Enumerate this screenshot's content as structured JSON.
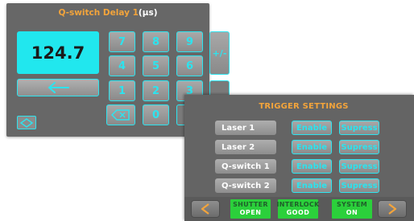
{
  "keypad": {
    "title_main": "Q-switch Delay 1",
    "title_unit": "(µs)",
    "display_value": "124.7",
    "keys": [
      "7",
      "8",
      "9",
      "4",
      "5",
      "6",
      "1",
      "2",
      "3",
      "0"
    ],
    "plus_minus": "+/-",
    "icons": {
      "back_arrow": "left-arrow-icon",
      "backspace": "backspace-icon",
      "toggle": "up-down-chevron-icon"
    },
    "accent_color": "#21e7ee",
    "title_highlight_color": "#f3a43b"
  },
  "trigger": {
    "title": "TRIGGER SETTINGS",
    "rows": [
      {
        "name": "Laser 1",
        "enable": "Enable",
        "supress": "Supress"
      },
      {
        "name": "Laser 2",
        "enable": "Enable",
        "supress": "Supress"
      },
      {
        "name": "Q-switch 1",
        "enable": "Enable",
        "supress": "Supress"
      },
      {
        "name": "Q-switch 2",
        "enable": "Enable",
        "supress": "Supress"
      }
    ],
    "status": [
      {
        "label": "SHUTTER",
        "state": "OPEN"
      },
      {
        "label": "INTERLOCK",
        "state": "GOOD"
      },
      {
        "label": "SYSTEM",
        "state": "ON"
      }
    ],
    "nav_icons": {
      "prev": "chevron-left-icon",
      "next": "chevron-right-icon"
    },
    "status_color": "#2bd03b",
    "nav_arrow_color": "#f3a43b"
  }
}
